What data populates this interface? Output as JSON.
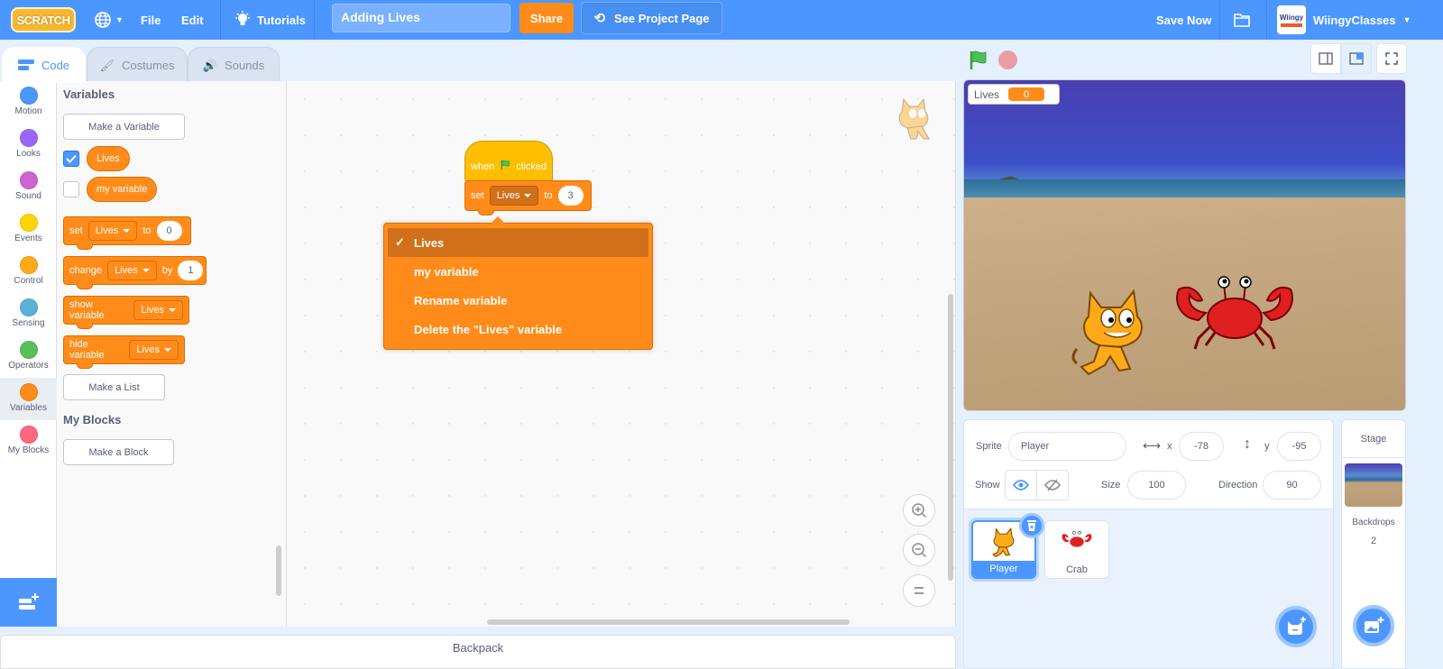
{
  "menubar": {
    "logo": "SCRATCH",
    "file": "File",
    "edit": "Edit",
    "tutorials": "Tutorials",
    "project_title": "Adding Lives",
    "share": "Share",
    "see_project_page": "See Project Page",
    "save_now": "Save Now",
    "username": "WiingyClasses",
    "avatar_text": "Wiingy"
  },
  "tabs": [
    {
      "label": "Code"
    },
    {
      "label": "Costumes"
    },
    {
      "label": "Sounds"
    }
  ],
  "categories": [
    {
      "label": "Motion",
      "color": "#4c97ff"
    },
    {
      "label": "Looks",
      "color": "#9966ff"
    },
    {
      "label": "Sound",
      "color": "#cf63cf"
    },
    {
      "label": "Events",
      "color": "#ffd500"
    },
    {
      "label": "Control",
      "color": "#ffab19"
    },
    {
      "label": "Sensing",
      "color": "#5cb1d6"
    },
    {
      "label": "Operators",
      "color": "#59c059"
    },
    {
      "label": "Variables",
      "color": "#ff8c1a"
    },
    {
      "label": "My Blocks",
      "color": "#ff6680"
    }
  ],
  "palette": {
    "variables_heading": "Variables",
    "make_variable": "Make a Variable",
    "variables": [
      {
        "name": "Lives",
        "checked": true
      },
      {
        "name": "my variable",
        "checked": false
      }
    ],
    "blocks": {
      "set": {
        "kw1": "set",
        "var": "Lives",
        "kw2": "to",
        "value": "0"
      },
      "change": {
        "kw1": "change",
        "var": "Lives",
        "kw2": "by",
        "value": "1"
      },
      "show": {
        "kw1": "show variable",
        "var": "Lives"
      },
      "hide": {
        "kw1": "hide variable",
        "var": "Lives"
      }
    },
    "make_list": "Make a List",
    "myblocks_heading": "My Blocks",
    "make_block": "Make a Block"
  },
  "workspace": {
    "hat": {
      "kw1": "when",
      "kw2": "clicked"
    },
    "set_block": {
      "kw1": "set",
      "var": "Lives",
      "kw2": "to",
      "value": "3"
    },
    "dropdown": {
      "items": [
        {
          "label": "Lives",
          "checked": true
        },
        {
          "label": "my variable",
          "checked": false
        },
        {
          "label": "Rename variable",
          "checked": false
        },
        {
          "label": "Delete the \"Lives\" variable",
          "checked": false
        }
      ],
      "check_glyph": "✓"
    }
  },
  "backpack": "Backpack",
  "stage": {
    "monitor_label": "Lives",
    "monitor_value": "0"
  },
  "sprite_info": {
    "sprite_label": "Sprite",
    "sprite_name": "Player",
    "x_label": "x",
    "x": "-78",
    "y_label": "y",
    "y": "-95",
    "show_label": "Show",
    "size_label": "Size",
    "size": "100",
    "direction_label": "Direction",
    "direction": "90"
  },
  "sprites": [
    {
      "name": "Player",
      "selected": true
    },
    {
      "name": "Crab",
      "selected": false
    }
  ],
  "stage_panel": {
    "title": "Stage",
    "backdrops_label": "Backdrops",
    "backdrops_count": "2"
  },
  "colors": {
    "accent": "#4c97ff",
    "variables": "#ff8c1a",
    "events": "#ffbf00"
  }
}
